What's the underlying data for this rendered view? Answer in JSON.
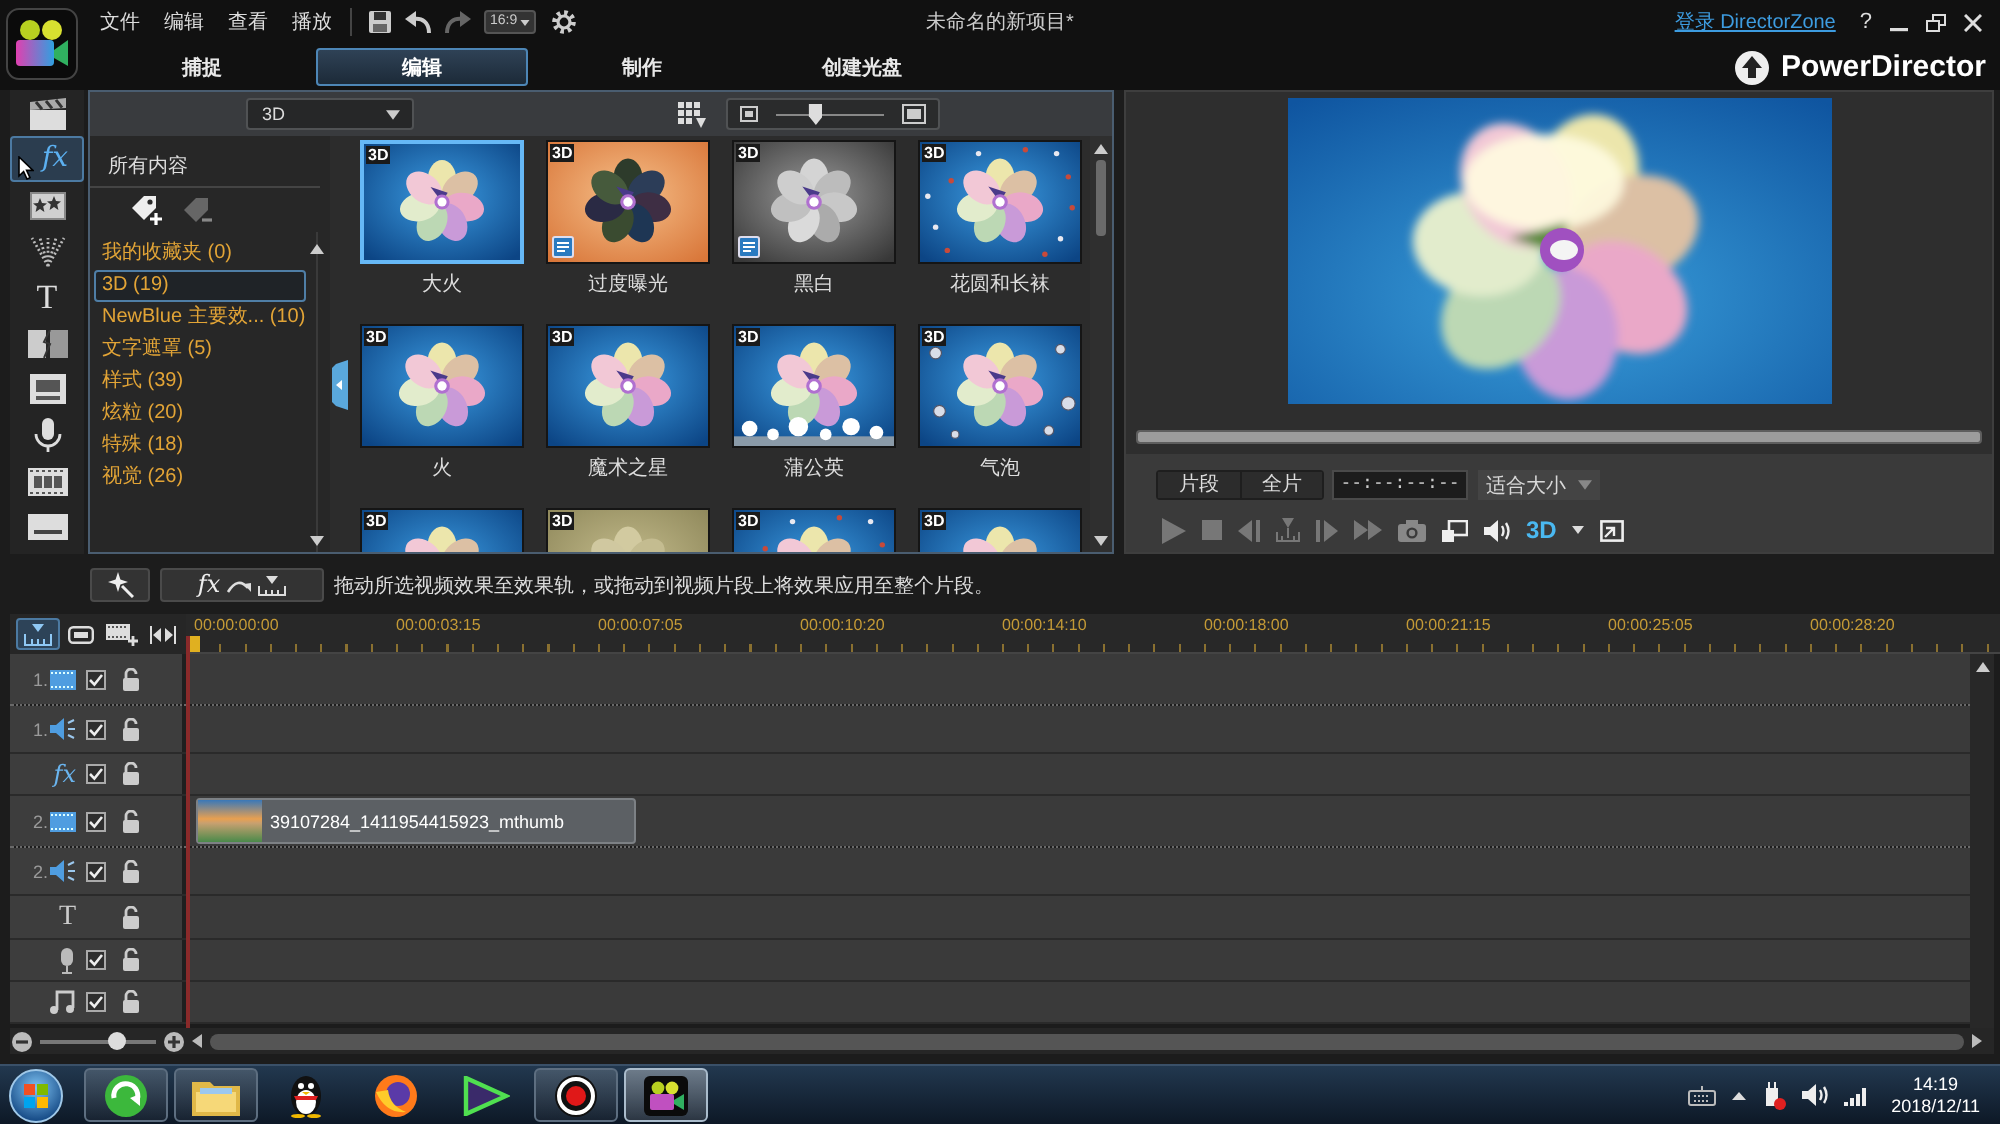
{
  "window": {
    "menu": [
      "文件",
      "编辑",
      "查看",
      "播放"
    ],
    "aspect": "16:9",
    "title": "未命名的新项目*",
    "login_link": "登录 DirectorZone",
    "help": "?"
  },
  "mode_tabs": [
    {
      "label": "捕捉",
      "selected": false
    },
    {
      "label": "编辑",
      "selected": true
    },
    {
      "label": "制作",
      "selected": false
    },
    {
      "label": "创建光盘",
      "selected": false
    }
  ],
  "brand": "PowerDirector",
  "room_rail": [
    {
      "kind": "media",
      "selected": false
    },
    {
      "kind": "effect",
      "glyph": "fx",
      "selected": true
    },
    {
      "kind": "pip",
      "selected": false
    },
    {
      "kind": "particle",
      "selected": false
    },
    {
      "kind": "title",
      "glyph": "T",
      "selected": false
    },
    {
      "kind": "transition",
      "selected": false
    },
    {
      "kind": "mixer",
      "selected": false
    },
    {
      "kind": "voice",
      "selected": false
    },
    {
      "kind": "chapter",
      "selected": false
    },
    {
      "kind": "subtitle",
      "selected": false
    }
  ],
  "library": {
    "filter": "3D",
    "thumbnail_size": {
      "level": 0.35
    },
    "header": "所有内容",
    "categories": [
      {
        "label": "我的收藏夹 (0)",
        "selected": false
      },
      {
        "label": "3D (19)",
        "selected": true
      },
      {
        "label": "NewBlue 主要效... (10)",
        "selected": false
      },
      {
        "label": "文字遮罩 (5)",
        "selected": false
      },
      {
        "label": "样式 (39)",
        "selected": false
      },
      {
        "label": "炫粒 (20)",
        "selected": false
      },
      {
        "label": "特殊 (18)",
        "selected": false
      },
      {
        "label": "视觉 (26)",
        "selected": false
      }
    ],
    "effects": [
      {
        "badge": "3D",
        "name": "大火",
        "kind": "plain",
        "tagged": false,
        "selected": true
      },
      {
        "badge": "3D",
        "name": "过度曝光",
        "kind": "overexposed",
        "tagged": true,
        "selected": false
      },
      {
        "badge": "3D",
        "name": "黑白",
        "kind": "grayscale",
        "tagged": true,
        "selected": false
      },
      {
        "badge": "3D",
        "name": "花圆和长袜",
        "kind": "speckled",
        "tagged": false,
        "selected": false
      },
      {
        "badge": "3D",
        "name": "火",
        "kind": "plain",
        "tagged": false,
        "selected": false
      },
      {
        "badge": "3D",
        "name": "魔术之星",
        "kind": "plain",
        "tagged": false,
        "selected": false
      },
      {
        "badge": "3D",
        "name": "蒲公英",
        "kind": "dandelion",
        "tagged": false,
        "selected": false
      },
      {
        "badge": "3D",
        "name": "气泡",
        "kind": "bubble",
        "tagged": false,
        "selected": false
      },
      {
        "badge": "3D",
        "kind": "plain",
        "tagged": false,
        "selected": false
      },
      {
        "badge": "3D",
        "kind": "olive",
        "tagged": false,
        "selected": false
      },
      {
        "badge": "3D",
        "kind": "speckled",
        "tagged": false,
        "selected": false
      },
      {
        "badge": "3D",
        "kind": "plain",
        "tagged": false,
        "selected": false
      }
    ]
  },
  "library_actions": {
    "fx_button": "fx",
    "hint": "拖动所选视频效果至效果轨，或拖动到视频片段上将效果应用至整个片段。"
  },
  "preview": {
    "seek": {
      "level": 1
    },
    "modes": [
      "片段",
      "全片"
    ],
    "timecode": "--:--:--:--",
    "fit": "适合大小",
    "stereo": "3D"
  },
  "timeline": {
    "tools": [
      {
        "kind": "timeline",
        "selected": true
      },
      {
        "kind": "storyboard",
        "selected": false
      },
      {
        "kind": "tracks",
        "selected": false
      },
      {
        "kind": "fit",
        "selected": false
      }
    ],
    "ruler": [
      "00:00:00:00",
      "00:00:03:15",
      "00:00:07:05",
      "00:00:10:20",
      "00:00:14:10",
      "00:00:18:00",
      "00:00:21:15",
      "00:00:25:05",
      "00:00:28:20"
    ],
    "tracks": [
      {
        "kind": "video",
        "number": "1.",
        "checked": true
      },
      {
        "kind": "audio",
        "number": "1.",
        "checked": true
      },
      {
        "kind": "effect",
        "glyph": "fx",
        "checked": true
      },
      {
        "kind": "video",
        "number": "2.",
        "checked": true,
        "clips": [
          {
            "name": "39107284_1411954415923_mthumb"
          }
        ]
      },
      {
        "kind": "audio",
        "number": "2.",
        "checked": true
      },
      {
        "kind": "title",
        "glyph": "T"
      },
      {
        "kind": "voice",
        "checked": true
      },
      {
        "kind": "music",
        "checked": true
      }
    ],
    "zoom": {
      "level": 0.7
    }
  },
  "taskbar": {
    "apps": [
      {
        "kind": "browser",
        "running": true,
        "selected": false
      },
      {
        "kind": "folder",
        "running": true,
        "selected": false
      },
      {
        "kind": "penguin",
        "running": false,
        "selected": false
      },
      {
        "kind": "fox",
        "running": false,
        "selected": false
      },
      {
        "kind": "triangle",
        "running": false,
        "selected": false
      },
      {
        "kind": "record",
        "running": true,
        "selected": false
      },
      {
        "kind": "camera",
        "running": true,
        "selected": true
      }
    ],
    "time": "14:19",
    "date": "2018/12/11"
  }
}
